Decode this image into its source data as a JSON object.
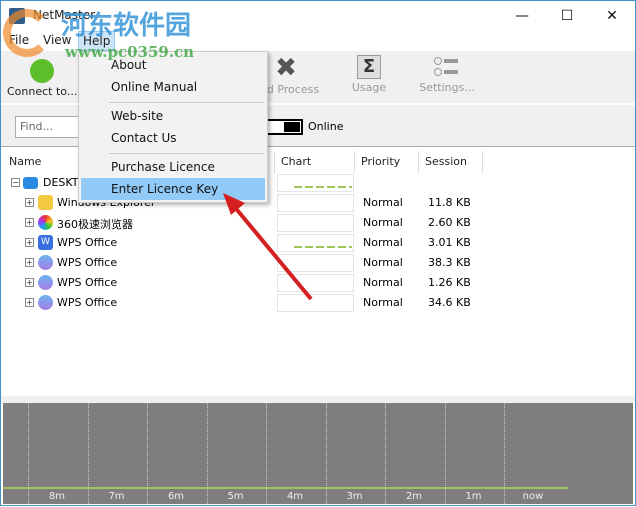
{
  "window": {
    "title": "NetMaster",
    "minimize": "—",
    "maximize": "☐",
    "close": "✕"
  },
  "menubar": [
    "File",
    "View",
    "Help"
  ],
  "help_menu": {
    "items": [
      "About",
      "Online Manual",
      "Web-site",
      "Contact Us",
      "Purchase Licence",
      "Enter Licence Key"
    ],
    "highlighted": "Enter Licence Key"
  },
  "toolbar": {
    "connect": "Connect to...",
    "end_process": "End Process",
    "usage": "Usage",
    "settings": "Settings..."
  },
  "findbar": {
    "placeholder": "Find...",
    "toggle_label": "Online"
  },
  "table": {
    "columns": [
      "Name",
      "Chart",
      "Priority",
      "Session"
    ],
    "root": "DESKTOP",
    "rows": [
      {
        "name": "Windows Explorer",
        "priority": "Normal",
        "session": "11.8 KB"
      },
      {
        "name": "360极速浏览器",
        "priority": "Normal",
        "session": "2.60 KB"
      },
      {
        "name": "WPS Office",
        "priority": "Normal",
        "session": "3.01 KB"
      },
      {
        "name": "WPS Office",
        "priority": "Normal",
        "session": "38.3 KB"
      },
      {
        "name": "WPS Office",
        "priority": "Normal",
        "session": "1.26 KB"
      },
      {
        "name": "WPS Office",
        "priority": "Normal",
        "session": "34.6 KB"
      }
    ]
  },
  "history_chart": {
    "ticks": [
      "8m",
      "7m",
      "6m",
      "5m",
      "4m",
      "3m",
      "2m",
      "1m",
      "now"
    ],
    "line_color": "#9ec55a",
    "background": "#7f7d80"
  },
  "watermark": {
    "site_name": "河东软件园",
    "url": "www.pc0359.cn"
  }
}
